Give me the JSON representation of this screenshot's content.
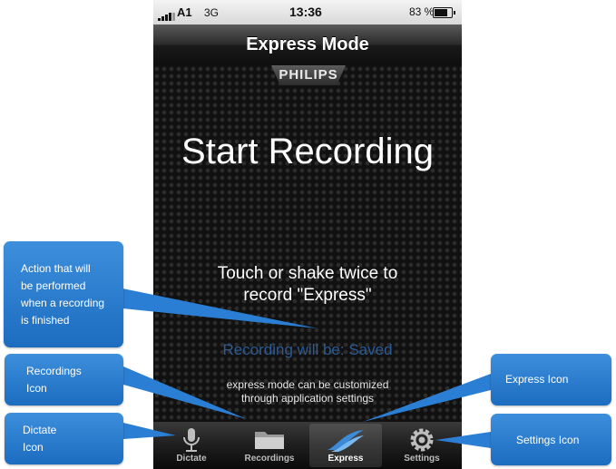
{
  "status_bar": {
    "carrier": "A1",
    "network": "3G",
    "time": "13:36",
    "battery": "83 %"
  },
  "header": {
    "title": "Express Mode",
    "brand": "PHILIPS"
  },
  "main": {
    "start_label": "Start Recording",
    "instruction_line1": "Touch or shake twice to",
    "instruction_line2": "record \"Express\"",
    "recording_status": "Recording will be: Saved",
    "customize_line1": "express mode can be customized",
    "customize_line2": "through application settings"
  },
  "tabbar": {
    "tabs": [
      {
        "label": "Dictate",
        "icon": "microphone-icon"
      },
      {
        "label": "Recordings",
        "icon": "folder-icon"
      },
      {
        "label": "Express",
        "icon": "express-wave-icon",
        "active": true
      },
      {
        "label": "Settings",
        "icon": "gear-icon"
      }
    ]
  },
  "callouts": {
    "action_line1": "Action that will",
    "action_line2": "be performed",
    "action_line3": "when a recording",
    "action_line4": "is finished",
    "recordings_line1": "Recordings",
    "recordings_line2": "Icon",
    "dictate_line1": "Dictate",
    "dictate_line2": "Icon",
    "express": "Express Icon",
    "settings": "Settings Icon"
  },
  "colors": {
    "callout_blue": "#2a7fd4",
    "status_text_blue": "#2b5a96",
    "tab_bar": "#1e1e1e"
  }
}
